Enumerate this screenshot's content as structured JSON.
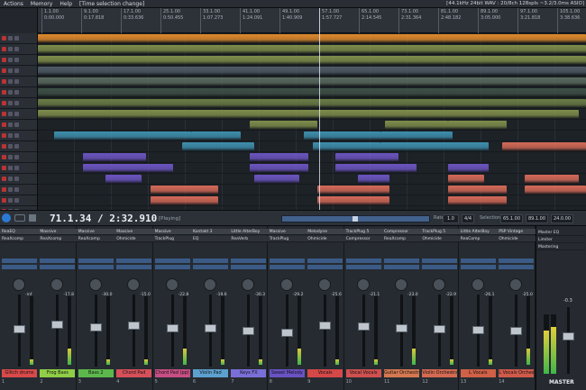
{
  "menu": {
    "items": [
      "Actions",
      "Memory",
      "Help"
    ],
    "selection_label": "[Time selection change]",
    "status": "[44.1kHz 24bit WAV : 20/8ch 128spls ~3.2/3.0ms ASIO]"
  },
  "ruler": {
    "bars": [
      "1.1.00",
      "9.1.00",
      "17.1.00",
      "25.1.00",
      "33.1.00",
      "41.1.00",
      "49.1.00",
      "57.1.00",
      "65.1.00",
      "73.1.00",
      "81.1.00",
      "89.1.00",
      "97.1.00",
      "105.1.00"
    ],
    "times": [
      "0:00.000",
      "0:17.818",
      "0:33.636",
      "0:50.455",
      "1:07.273",
      "1:24.091",
      "1:40.909",
      "1:57.727",
      "2:14.545",
      "2:31.364",
      "2:48.182",
      "3:05.000",
      "3:21.818",
      "3:38.636"
    ]
  },
  "transport": {
    "time": "71.1.34 / 2:32.910",
    "status": "[Playing]",
    "rate_label": "Rate:",
    "rate_value": "1.0",
    "bpm": "4/4",
    "selection_label": "Selection:",
    "sel_start": "65.1.00",
    "sel_end": "89.1.00",
    "sel_len": "24.0.00"
  },
  "mixer": {
    "channels": [
      {
        "num": "1",
        "name": "Glitch drums",
        "color": "#d84a4a",
        "inserts": [
          "ReaEQ",
          "ReaXcomp"
        ],
        "db": "-inf",
        "fader": 0.55
      },
      {
        "num": "2",
        "name": "Frog Bass",
        "color": "#8fce46",
        "inserts": [
          "Massive",
          "ReaXcomp"
        ],
        "db": "-17.8",
        "fader": 0.62
      },
      {
        "num": "3",
        "name": "Bass 2",
        "color": "#5db84c",
        "inserts": [
          "Massive",
          "ReaXcomp"
        ],
        "db": "-30.0",
        "fader": 0.58
      },
      {
        "num": "4",
        "name": "Chord Pad",
        "color": "#d6505a",
        "inserts": [
          "Massive",
          "Ohmicide"
        ],
        "db": "-15.0",
        "fader": 0.6
      },
      {
        "num": "5",
        "name": "Chord Pad (pp)",
        "color": "#c74f84",
        "inserts": [
          "Massive",
          "TrackPlug"
        ],
        "db": "-22.8",
        "fader": 0.56
      },
      {
        "num": "6",
        "name": "Violin Pad",
        "color": "#5ca0cf",
        "inserts": [
          "Kontakt 3",
          "EQ"
        ],
        "db": "-19.6",
        "fader": 0.57
      },
      {
        "num": "7",
        "name": "Keys FX",
        "color": "#7a6fd8",
        "inserts": [
          "Little AlterBoy",
          "ReaVerb"
        ],
        "db": "-30.3",
        "fader": 0.52
      },
      {
        "num": "8",
        "name": "Sweet Melody",
        "color": "#6a52c4",
        "inserts": [
          "Massive",
          "TrackPlug"
        ],
        "db": "-29.2",
        "fader": 0.5
      },
      {
        "num": "9",
        "name": "Vocals",
        "color": "#d44848",
        "inserts": [
          "Melodyne",
          "Ohmicide"
        ],
        "db": "-25.6",
        "fader": 0.6
      },
      {
        "num": "10",
        "name": "Vocal Vocals",
        "color": "#cf5050",
        "inserts": [
          "TrackPlug 5",
          "Compressor"
        ],
        "db": "-21.1",
        "fader": 0.59
      },
      {
        "num": "11",
        "name": "Guitar Orchestra",
        "color": "#d47850",
        "inserts": [
          "Compressor",
          "ReaXcomp"
        ],
        "db": "-23.0",
        "fader": 0.57
      },
      {
        "num": "12",
        "name": "Violin Orchestra",
        "color": "#d46a52",
        "inserts": [
          "TrackPlug 5",
          "Ohmicide"
        ],
        "db": "-22.9",
        "fader": 0.55
      },
      {
        "num": "13",
        "name": "L Vocals",
        "color": "#d06046",
        "inserts": [
          "Little AlterBoy",
          "ReaComp"
        ],
        "db": "-26.1",
        "fader": 0.54
      },
      {
        "num": "14",
        "name": "L Vocals Orchestra",
        "color": "#d05a4a",
        "inserts": [
          "PSP Vintage",
          "Ohmicide"
        ],
        "db": "-25.0",
        "fader": 0.53
      }
    ]
  },
  "master": {
    "label": "MASTER",
    "inserts": [
      "Master EQ",
      "Limiter",
      "Mastering"
    ],
    "db": "-0.3",
    "fader": 0.62
  },
  "colors": {
    "orange_clip": "#e08a2a",
    "olive_clip": "#7f8d4a",
    "teal_clip": "#3e8fae",
    "purple_clip": "#6c55c2",
    "salmon_clip": "#d66a58"
  }
}
